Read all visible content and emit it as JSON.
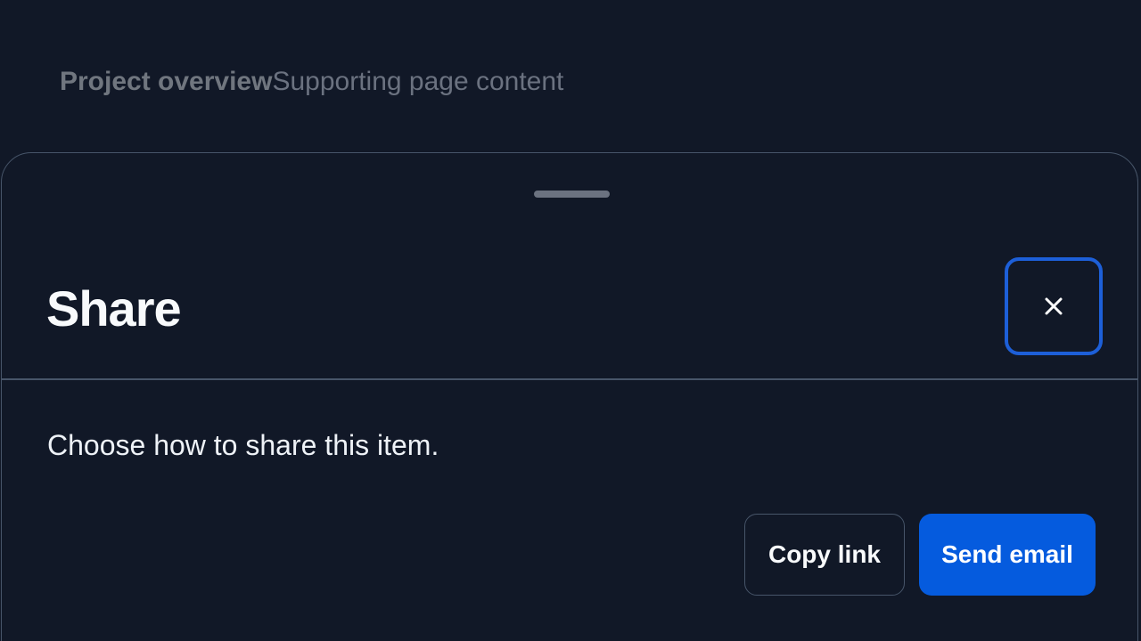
{
  "background": {
    "title": "Project overview",
    "subtitle": "Supporting page content"
  },
  "sheet": {
    "title": "Share",
    "description": "Choose how to share this item.",
    "close_label": "Close",
    "close_icon": "close-icon",
    "actions": {
      "secondary_label": "Copy link",
      "primary_label": "Send email"
    }
  },
  "colors": {
    "background": "#111827",
    "border": "#475569",
    "accent": "#055bde",
    "focus_ring": "#1d5fd8"
  }
}
